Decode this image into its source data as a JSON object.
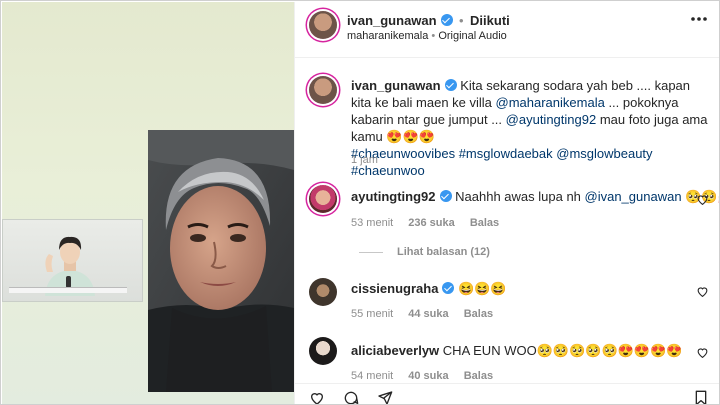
{
  "post": {
    "author": "ivan_gunawan",
    "follow_status": "Diikuti",
    "dot": "•",
    "audio_user": "maharanikemala",
    "audio_label": "Original Audio",
    "more_icon": "more-horizontal-icon"
  },
  "caption": {
    "author": "ivan_gunawan",
    "text1": "Kita sekarang sodara yah beb .... kapan kita ke bali maen ke villa ",
    "mention1": "@maharanikemala",
    "text2": " ... pokoknya kabarin ntar gue jumput ... ",
    "mention2": "@ayutingting92",
    "text3": " mau foto juga ama kamu 😍😍😍",
    "hashtags": "#chaeunwoovibes #msglowdaebak @msglowbeauty #chaeunwoo",
    "time": "1 jam"
  },
  "comments": [
    {
      "user": "ayutingting92",
      "text": "Naahhh awas lupa nh ",
      "mention": "@ivan_gunawan",
      "emoji": "🥺🥺💋",
      "time": "53 menit",
      "likes": "236 suka",
      "reply": "Balas",
      "view_replies": "Lihat balasan (12)"
    },
    {
      "user": "cissienugraha",
      "text": "😆😆😆",
      "time": "55 menit",
      "likes": "44 suka",
      "reply": "Balas"
    },
    {
      "user": "aliciabeverlyw",
      "text": "CHA EUN WOO🥺🥺🥺🥺🥺😍😍😍😍",
      "time": "54 menit",
      "likes": "40 suka",
      "reply": "Balas"
    }
  ],
  "colors": {
    "verified": "#3897f0",
    "link": "#00376b",
    "muted": "#8e8e8e"
  }
}
